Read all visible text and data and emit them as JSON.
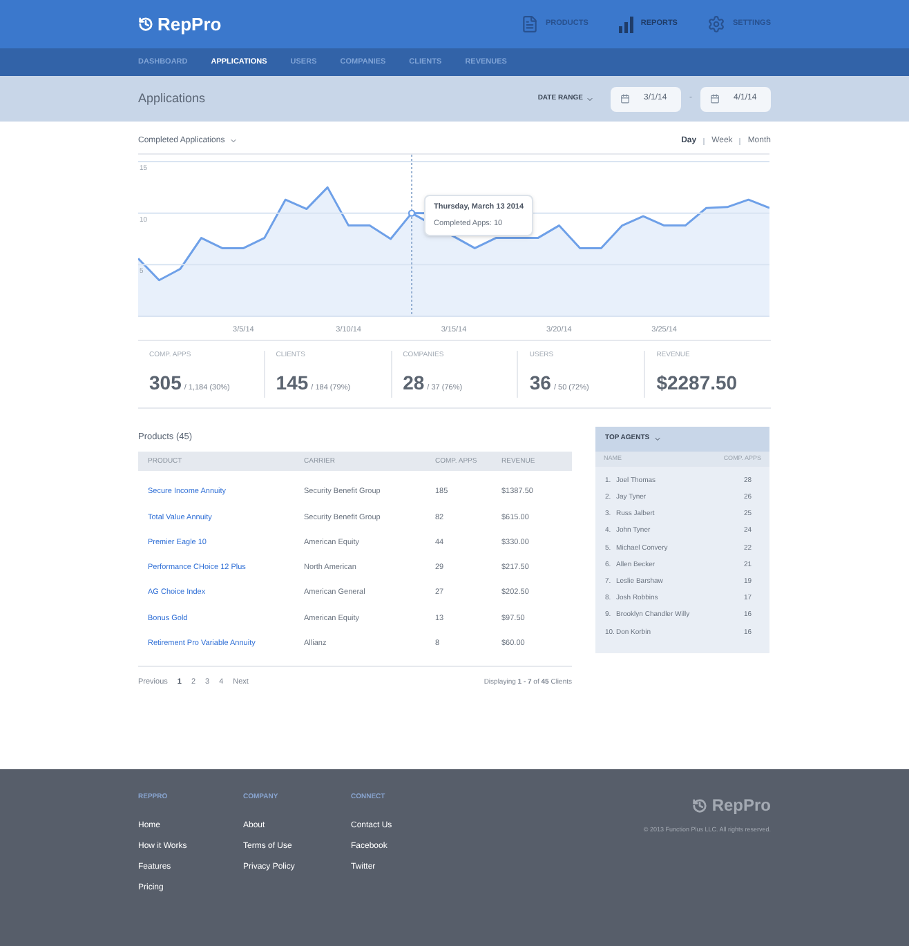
{
  "header": {
    "logo": "RepPro",
    "nav": [
      {
        "kind": "document",
        "label": "PRODUCTS",
        "selected": false
      },
      {
        "kind": "bars",
        "label": "REPORTS",
        "selected": true
      },
      {
        "kind": "gear",
        "label": "SETTINGS",
        "selected": false
      }
    ]
  },
  "tabs": [
    {
      "label": "DASHBOARD",
      "selected": false
    },
    {
      "label": "APPLICATIONS",
      "selected": true
    },
    {
      "label": "USERS",
      "selected": false
    },
    {
      "label": "COMPANIES",
      "selected": false
    },
    {
      "label": "CLIENTS",
      "selected": false
    },
    {
      "label": "REVENUES",
      "selected": false
    }
  ],
  "page_title": "Applications",
  "date_range": {
    "label": "DATE RANGE",
    "from": "3/1/14",
    "separator": "-",
    "to": "4/1/14"
  },
  "chart_section": {
    "metric": "Completed Applications",
    "periods": [
      {
        "label": "Day",
        "selected": true
      },
      {
        "label": "Week",
        "selected": false
      },
      {
        "label": "Month",
        "selected": false
      }
    ],
    "tooltip_text": "Completed Apps: 10",
    "chart_data": {
      "type": "area",
      "categories": [
        null,
        null,
        null,
        null,
        null,
        "3/5/14",
        null,
        null,
        null,
        null,
        "3/10/14",
        null,
        null,
        null,
        null,
        "3/15/14",
        null,
        null,
        null,
        null,
        "3/20/14",
        null,
        null,
        null,
        null,
        "3/25/14",
        null,
        null,
        null,
        null,
        null
      ],
      "series": [
        {
          "color": "#6ea0e8",
          "values": [
            5.6,
            3.5,
            4.6,
            7.6,
            6.6,
            6.6,
            7.6,
            11.3,
            10.4,
            12.5,
            8.8,
            8.8,
            7.5,
            10,
            null,
            null,
            6.6,
            7.6,
            null,
            7.6,
            8.8,
            6.6,
            6.6,
            8.8,
            9.7,
            8.8,
            8.8,
            10.5,
            10.6,
            11.3,
            10.5
          ]
        }
      ],
      "ylim": [
        0,
        15
      ],
      "yticks": [
        5,
        10,
        15
      ],
      "annotations": [
        "Thursday, March 13 2014"
      ]
    }
  },
  "stats": [
    {
      "label": "COMP. APPS",
      "value": "305",
      "detail": "/ 1,184 (30%)"
    },
    {
      "label": "CLIENTS",
      "value": "145",
      "detail": "/ 184 (79%)"
    },
    {
      "label": "COMPANIES",
      "value": "28",
      "detail": "/ 37 (76%)"
    },
    {
      "label": "USERS",
      "value": "36",
      "detail": "/ 50 (72%)"
    },
    {
      "label": "REVENUE",
      "value": "$2287.50"
    }
  ],
  "products": {
    "title": "Products (45)",
    "columns": [
      "PRODUCT",
      "CARRIER",
      "COMP. APPS",
      "REVENUE"
    ],
    "rows": [
      [
        "Secure Income Annuity",
        "Security Benefit Group",
        "185",
        "$1387.50"
      ],
      [
        "Total Value Annuity",
        "Security Benefit Group",
        "82",
        "$615.00"
      ],
      [
        "Premier Eagle 10",
        "American Equity",
        "44",
        "$330.00"
      ],
      [
        "Performance CHoice 12 Plus",
        "North American",
        "29",
        "$217.50"
      ],
      [
        "AG Choice Index",
        "American General",
        "27",
        "$202.50"
      ],
      [
        "Bonus Gold",
        "American Equity",
        "13",
        "$97.50"
      ],
      [
        "Retirement Pro Variable Annuity",
        "Allianz",
        "8",
        "$60.00"
      ]
    ],
    "pagination": {
      "previous": "Previous",
      "pages": [
        {
          "label": "1",
          "selected": true
        },
        {
          "label": "2",
          "selected": false
        },
        {
          "label": "3",
          "selected": false
        },
        {
          "label": "4",
          "selected": false
        }
      ],
      "next": "Next"
    },
    "summary": "Displaying **1 - 7** of **45** Clients"
  },
  "top_agents": {
    "title": "TOP AGENTS",
    "columns": [
      "NAME",
      "COMP. APPS"
    ],
    "rows": [
      {
        "rank": "1.",
        "name": "Joel Thomas",
        "apps": "28"
      },
      {
        "rank": "2.",
        "name": "Jay Tyner",
        "apps": "26"
      },
      {
        "rank": "3.",
        "name": "Russ Jalbert",
        "apps": "25"
      },
      {
        "rank": "4.",
        "name": "John Tyner",
        "apps": "24"
      },
      {
        "rank": "5.",
        "name": "Michael Convery",
        "apps": "22"
      },
      {
        "rank": "6.",
        "name": "Allen Becker",
        "apps": "21"
      },
      {
        "rank": "7.",
        "name": "Leslie Barshaw",
        "apps": "19"
      },
      {
        "rank": "8.",
        "name": "Josh Robbins",
        "apps": "17"
      },
      {
        "rank": "9.",
        "name": "Brooklyn Chandler Willy",
        "apps": "16"
      },
      {
        "rank": "10.",
        "name": "Don Korbin",
        "apps": "16"
      }
    ]
  },
  "footer": {
    "columns": [
      {
        "heading": "REPPRO",
        "links": [
          "Home",
          "How it Works",
          "Features",
          "Pricing"
        ]
      },
      {
        "heading": "COMPANY",
        "links": [
          "About",
          "Terms of Use",
          "Privacy Policy"
        ]
      },
      {
        "heading": "CONNECT",
        "links": [
          "Contact Us",
          "Facebook",
          "Twitter"
        ]
      }
    ],
    "logo": "RepPro",
    "copyright": "© 2013 Function Plus LLC. All rights reserved."
  }
}
